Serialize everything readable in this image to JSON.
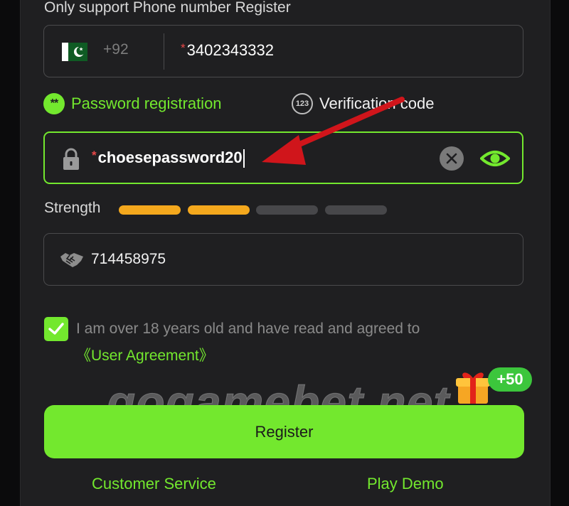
{
  "form": {
    "heading": "Only support Phone number Register",
    "phone": {
      "country_code": "+92",
      "required_mark": "*",
      "value": "3402343332",
      "flag": "pakistan-flag"
    },
    "tabs": [
      {
        "label": "Password registration",
        "icon_text": "**",
        "active": true
      },
      {
        "label": "Verification code",
        "icon_text": "123",
        "active": false
      }
    ],
    "password": {
      "required_mark": "*",
      "value": "choesepassword20",
      "icons": {
        "left": "lock-icon",
        "clear": "clear-icon",
        "toggle": "eye-icon"
      }
    },
    "strength": {
      "label": "Strength",
      "level": 2,
      "max": 4
    },
    "invite": {
      "value": "714458975",
      "icon": "handshake-icon"
    },
    "agreement": {
      "checked": true,
      "text": "I am over 18 years old and have read and agreed to",
      "link": "《User Agreement》"
    },
    "bonus": "+50",
    "register_label": "Register",
    "footer": {
      "customer_service": "Customer Service",
      "play_demo": "Play Demo"
    },
    "watermark": "gogamebet.net"
  },
  "colors": {
    "accent": "#73e82e",
    "strength_on": "#f4a81d",
    "strength_off": "#47474a",
    "required": "#e94848",
    "annotation_arrow": "#d0151b"
  }
}
